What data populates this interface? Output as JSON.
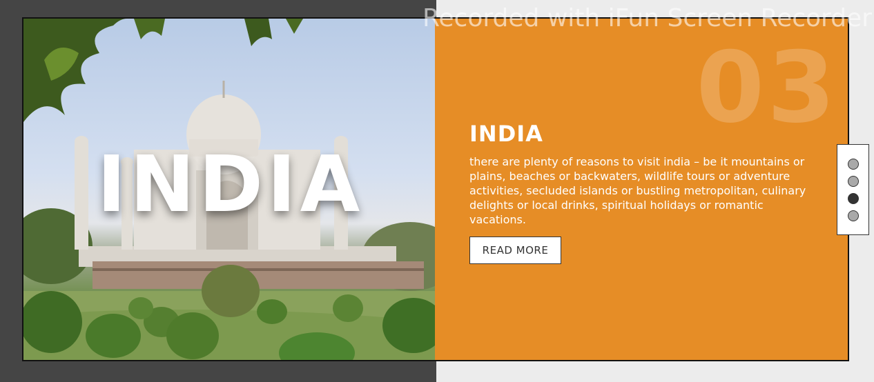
{
  "slide": {
    "image_title": "INDIA",
    "number": "03",
    "title": "INDIA",
    "description": "there are plenty of reasons to visit india – be it mountains or plains, beaches or backwaters, wildlife tours or adventure activities, secluded islands or bustling metropolitan, culinary delights or local drinks, spiritual holidays or romantic vacations.",
    "button_label": "READ MORE"
  },
  "pager": {
    "count": 4,
    "active_index": 2
  },
  "watermark": "Recorded with iFun Screen Recorder",
  "colors": {
    "accent": "#e68d26",
    "left_background": "#454545",
    "right_background": "#ececec",
    "dot_active": "#333333",
    "dot_inactive": "#a9a9a9"
  }
}
